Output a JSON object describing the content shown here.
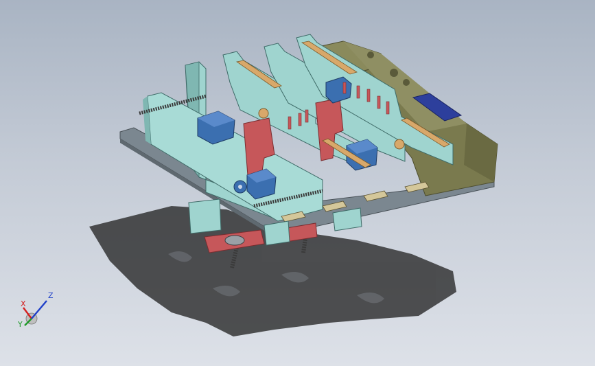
{
  "viewport": {
    "background_top": "#a9b4c3",
    "background_bottom": "#dde1e8"
  },
  "model": {
    "plate_color": "#9fd4cf",
    "base_color": "#7b8790",
    "bracket_color": "#c6575a",
    "motor_color": "#3b6fb0",
    "enclosure_color": "#7a7a4e",
    "screen_color": "#2d3f9c",
    "rail_color": "#d8a86a",
    "shadow_color": "#2b2b2b"
  },
  "triad": {
    "x_label": "X",
    "y_label": "Y",
    "z_label": "Z",
    "x_color": "#d42020",
    "y_color": "#1f9a2a",
    "z_color": "#1e3fc8"
  }
}
